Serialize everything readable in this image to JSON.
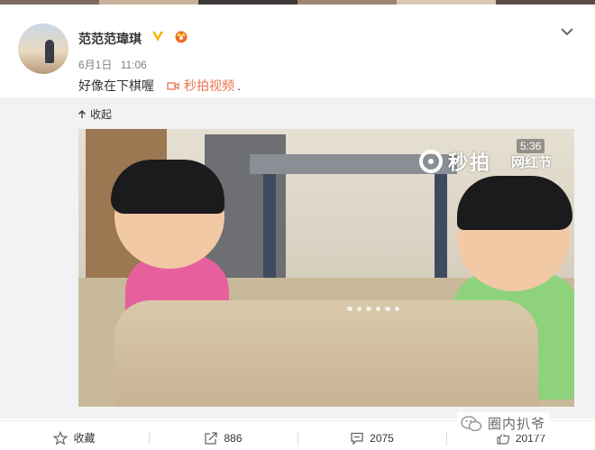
{
  "post": {
    "username": "范范范瑋琪",
    "date": "6月1日",
    "time": "11:06",
    "text": "好像在下棋喔",
    "video_link_label": "秒拍视频",
    "video_link_trail": ".",
    "collapse_label": "收起"
  },
  "video": {
    "watermark": "秒拍",
    "watermark_tag": "网红节",
    "duration": "5:36"
  },
  "actions": [
    {
      "icon": "star-icon",
      "label": "收藏"
    },
    {
      "icon": "share-icon",
      "label": "886"
    },
    {
      "icon": "comment-icon",
      "label": "2075"
    },
    {
      "icon": "like-icon",
      "label": "20177"
    }
  ],
  "stamp": "圈内扒爷",
  "colors": {
    "accent": "#eb7350",
    "verified": "#f7b500",
    "media_bg": "#f2f2f5"
  }
}
